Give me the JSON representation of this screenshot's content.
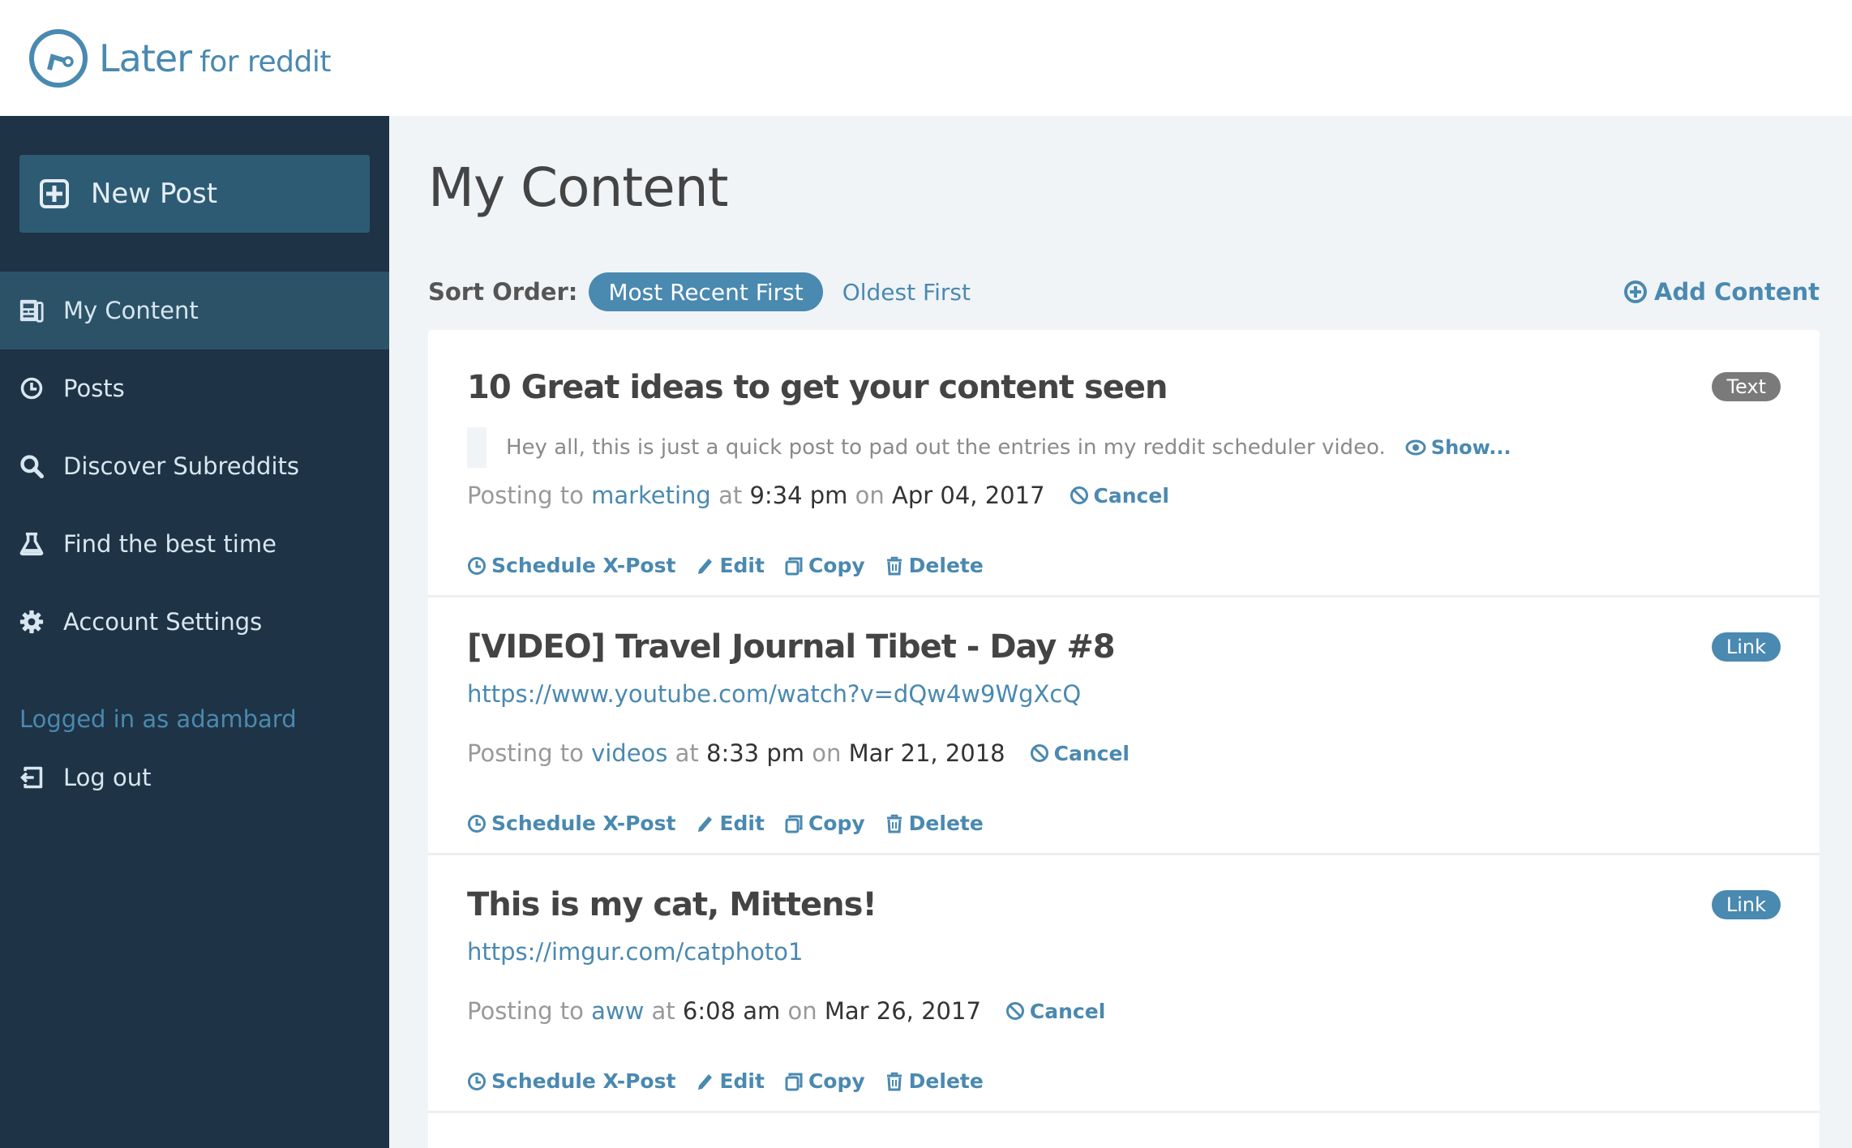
{
  "app": {
    "logo_main": "Later",
    "logo_sub": "for reddit",
    "accent_color": "#4a89b0",
    "sidebar_color": "#1e3345"
  },
  "sidebar": {
    "new_post_label": "New Post",
    "items": [
      {
        "label": "My Content",
        "icon": "newspaper-icon",
        "active": true
      },
      {
        "label": "Posts",
        "icon": "clock-icon",
        "active": false
      },
      {
        "label": "Discover Subreddits",
        "icon": "search-icon",
        "active": false
      },
      {
        "label": "Find the best time",
        "icon": "flask-icon",
        "active": false
      },
      {
        "label": "Account Settings",
        "icon": "gear-icon",
        "active": false
      }
    ],
    "logged_in_text": "Logged in as adambard",
    "logout_label": "Log out"
  },
  "main": {
    "title": "My Content",
    "sort_label": "Sort Order:",
    "sort_options": [
      "Most Recent First",
      "Oldest First"
    ],
    "sort_selected": "Most Recent First",
    "add_content_label": "Add Content",
    "posting_to": "Posting to",
    "at": "at",
    "on": "on",
    "cancel_label": "Cancel",
    "show_label": "Show...",
    "actions": {
      "schedule": "Schedule X-Post",
      "edit": "Edit",
      "copy": "Copy",
      "delete": "Delete"
    },
    "cards": [
      {
        "title": "10 Great ideas to get your content seen",
        "type": "Text",
        "body": "Hey all, this is just a quick post to pad out the entries in my reddit scheduler video.",
        "subreddit": "marketing",
        "time": "9:34 pm",
        "date": "Apr 04, 2017"
      },
      {
        "title": "[VIDEO] Travel Journal Tibet - Day #8",
        "type": "Link",
        "url": "https://www.youtube.com/watch?v=dQw4w9WgXcQ",
        "subreddit": "videos",
        "time": "8:33 pm",
        "date": "Mar 21, 2018"
      },
      {
        "title": "This is my cat, Mittens!",
        "type": "Link",
        "url": "https://imgur.com/catphoto1",
        "subreddit": "aww",
        "time": "6:08 am",
        "date": "Mar 26, 2017"
      }
    ]
  }
}
